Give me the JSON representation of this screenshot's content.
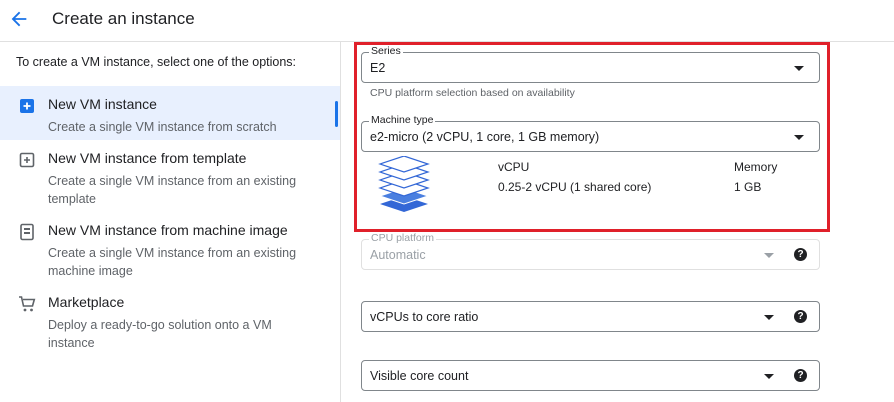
{
  "header": {
    "title": "Create an instance",
    "back_icon": "arrow-back-icon"
  },
  "sidebar": {
    "intro": "To create a VM instance, select one of the options:",
    "options": [
      {
        "title": "New VM instance",
        "description": "Create a single VM instance from scratch",
        "icon": "add-box-icon",
        "selected": true
      },
      {
        "title": "New VM instance from template",
        "description": "Create a single VM instance from an existing template",
        "icon": "template-add-icon",
        "selected": false
      },
      {
        "title": "New VM instance from machine image",
        "description": "Create a single VM instance from an existing machine image",
        "icon": "machine-image-icon",
        "selected": false
      },
      {
        "title": "Marketplace",
        "description": "Deploy a ready-to-go solution onto a VM instance",
        "icon": "cart-icon",
        "selected": false
      }
    ]
  },
  "machine": {
    "series": {
      "label": "Series",
      "value": "E2",
      "hint": "CPU platform selection based on availability"
    },
    "machine_type": {
      "label": "Machine type",
      "value": "e2-micro (2 vCPU, 1 core, 1 GB memory)"
    },
    "specs": {
      "vcpu_header": "vCPU",
      "vcpu_value": "0.25-2 vCPU (1 shared core)",
      "memory_header": "Memory",
      "memory_value": "1 GB"
    },
    "cpu_platform": {
      "label": "CPU platform",
      "value": "Automatic",
      "disabled": true
    },
    "vcpu_ratio": {
      "placeholder": "vCPUs to core ratio"
    },
    "visible_cores": {
      "placeholder": "Visible core count"
    }
  },
  "colors": {
    "accent": "#1a73e8",
    "highlight": "#e0202a",
    "selected_bg": "#e8f0fe",
    "stack_icon": "#3367d6"
  }
}
